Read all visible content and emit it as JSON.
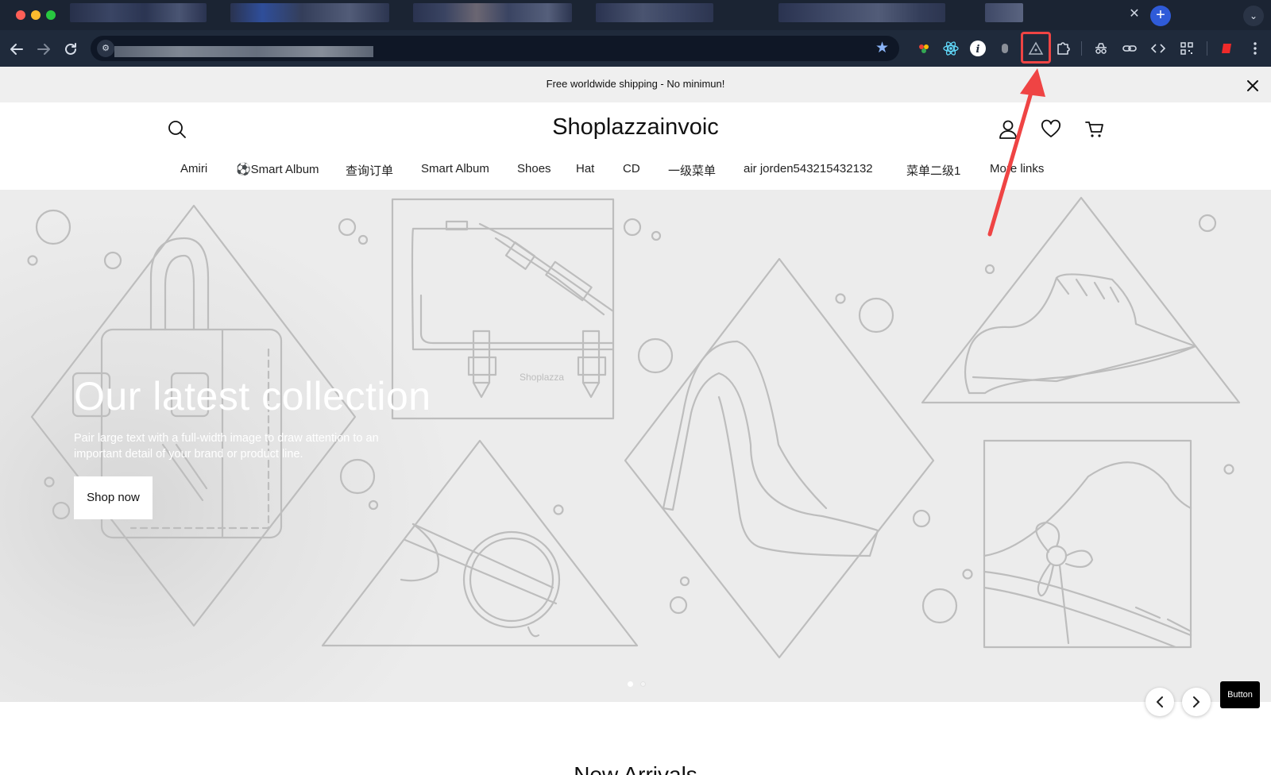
{
  "announcement": {
    "text": "Free worldwide shipping - No minimun!"
  },
  "header": {
    "store_name": "Shoplazzainvoic"
  },
  "nav": {
    "items": [
      "Amiri",
      "⚽Smart Album",
      "查询订单",
      "Smart Album",
      "Shoes",
      "Hat",
      "CD",
      "一级菜单",
      "air jorden543215432132",
      "菜单二级1",
      "More links"
    ]
  },
  "hero": {
    "title": "Our latest collection",
    "description": "Pair large text with a full-width image to draw attention to an important detail of your brand or product line.",
    "cta_label": "Shop now",
    "watermark": "Shoplazza",
    "slide_count": 2,
    "active_slide": 1
  },
  "floating": {
    "button_label": "Button"
  },
  "section": {
    "heading": "New Arrivals"
  },
  "icons": {
    "back": "back-arrow-icon",
    "forward": "forward-arrow-icon",
    "reload": "reload-icon",
    "bookmark": "star-icon",
    "search": "search-icon",
    "account": "user-icon",
    "wishlist": "heart-icon",
    "cart": "cart-icon",
    "close": "close-icon"
  },
  "colors": {
    "browser_tabstrip": "#1b2433",
    "browser_toolbar": "#1f2a3b",
    "announcement_bg": "#efefef",
    "hero_bg": "#ececec",
    "highlight": "#ef4444",
    "new_tab": "#2f5bd8"
  }
}
